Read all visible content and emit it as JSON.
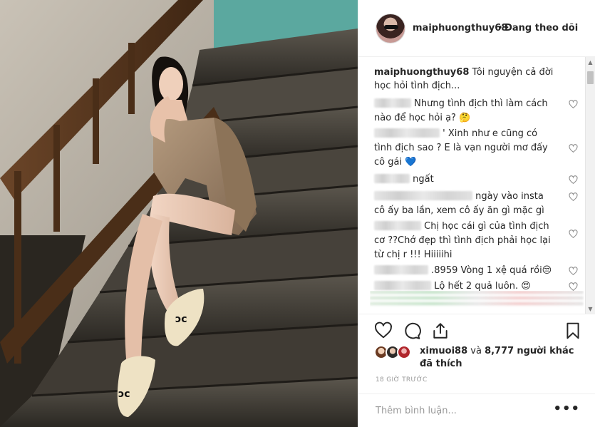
{
  "post": {
    "username": "maiphuongthuy68",
    "separator": "•",
    "follow_status": "Đang theo dõi"
  },
  "caption": {
    "username": "maiphuongthuy68",
    "text": "Tôi nguyện cả đời học hỏi tình địch..."
  },
  "comments": [
    {
      "text": "Nhưng tình địch thì làm cách nào để học hỏi ạ? 🤔",
      "hidden_user": true
    },
    {
      "text": "' Xinh như e cũng có tình địch sao ? E là vạn người mơ đấy cô gái 💙",
      "hidden_user": true
    },
    {
      "text": "ngất",
      "hidden_user": true
    },
    {
      "text": "ngày vào insta cô ấy ba lần, xem cô ấy ăn gì mặc gì",
      "hidden_user": true
    },
    {
      "text": "Chị học cái gì của tình địch cơ ??Chớ đẹp thì tình địch phải học lại từ chị r !!! Hiiiiihi",
      "hidden_user": true
    },
    {
      "text": ".8959 Vòng 1 xệ quá rồi😒",
      "hidden_user": true
    },
    {
      "text": "Lộ hết 2 quả luôn. 😍",
      "hidden_user": true
    }
  ],
  "actions": {
    "like": "heart-icon",
    "comment": "comment-icon",
    "share": "share-icon",
    "save": "bookmark-icon"
  },
  "likes": {
    "first_user": "ximuoi88",
    "connector": "và",
    "count": "8,777",
    "others_label": "người khác",
    "line2": "đã thích"
  },
  "timestamp": "18 GIỜ TRƯỚC",
  "add_comment": {
    "placeholder": "Thêm bình luận...",
    "more": "•••"
  }
}
